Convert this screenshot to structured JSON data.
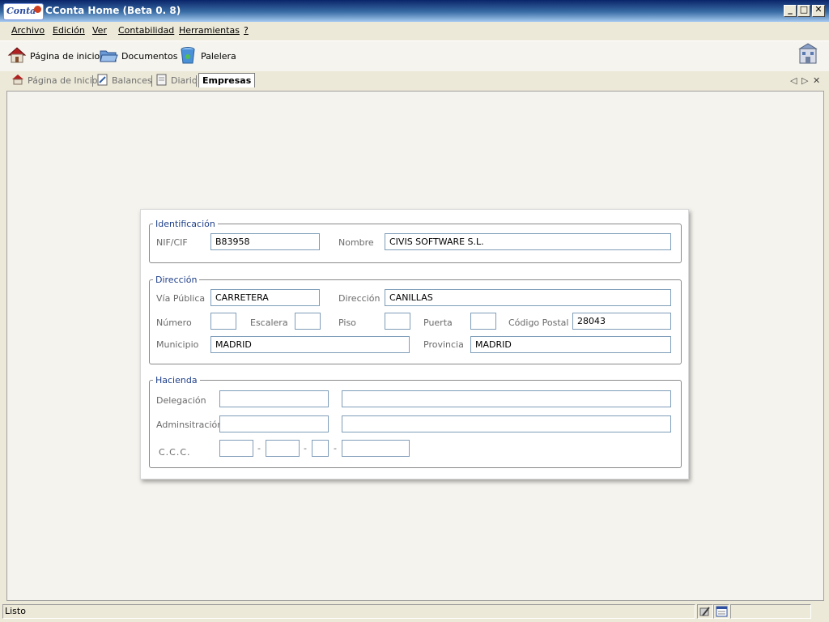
{
  "window": {
    "logo_text": "Conta",
    "title": "CConta Home (Beta 0. 8)",
    "minimize_glyph": "_",
    "maximize_glyph": "□",
    "close_glyph": "✕"
  },
  "menu": {
    "items": [
      "Archivo",
      "Edición",
      "Ver",
      "Contabilidad",
      "Herramientas",
      "?"
    ]
  },
  "toolbar": {
    "home_label": "Página de inicio",
    "home_icon": "house-icon",
    "documents_label": "Documentos",
    "documents_icon": "folder-icon",
    "trash_label": "Palelera",
    "trash_icon": "recycle-bin-icon",
    "right_icon": "building-icon"
  },
  "tabs": {
    "items": [
      {
        "label": "Página de Inicio",
        "icon": "house-icon",
        "active": false
      },
      {
        "label": "Balances",
        "icon": "document-edit-icon",
        "active": false
      },
      {
        "label": "Diario",
        "icon": "document-icon",
        "active": false
      },
      {
        "label": "Empresas",
        "icon": "",
        "active": true
      }
    ],
    "nav_prev": "◁",
    "nav_next": "▷",
    "nav_close": "✕"
  },
  "form": {
    "identificacion": {
      "legend": "Identificación",
      "nif_label": "NIF/CIF",
      "nif_value": "B83958",
      "nombre_label": "Nombre",
      "nombre_value": "CIVIS SOFTWARE S.L."
    },
    "direccion": {
      "legend": "Dirección",
      "via_label": "Vía Pública",
      "via_value": "CARRETERA",
      "direccion_label": "Dirección",
      "direccion_value": "CANILLAS",
      "numero_label": "Número",
      "numero_value": "",
      "escalera_label": "Escalera",
      "escalera_value": "",
      "piso_label": "Piso",
      "piso_value": "",
      "puerta_label": "Puerta",
      "puerta_value": "",
      "cp_label": "Código Postal",
      "cp_value": "28043",
      "municipio_label": "Municipio",
      "municipio_value": "MADRID",
      "provincia_label": "Provincia",
      "provincia_value": "MADRID"
    },
    "hacienda": {
      "legend": "Hacienda",
      "delegacion_label": "Delegación",
      "delegacion_code": "",
      "delegacion_name": "",
      "administracion_label": "Adminsitración",
      "administracion_code": "",
      "administracion_name": "",
      "ccc_label": "C.C.C.",
      "ccc_entidad": "",
      "ccc_oficina": "",
      "ccc_dc": "",
      "ccc_cuenta": "",
      "separator": "-"
    }
  },
  "status": {
    "text": "Listo"
  },
  "colors": {
    "title_bar": "#0a246a",
    "legend_text": "#1e3f8a",
    "input_border": "#7f9db9"
  }
}
